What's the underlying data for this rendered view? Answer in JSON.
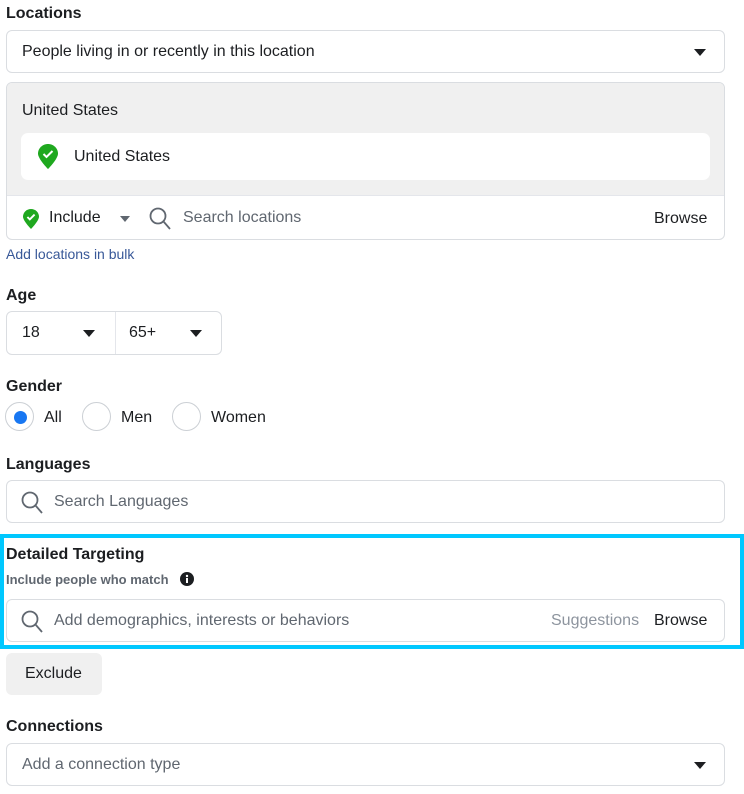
{
  "locations": {
    "label": "Locations",
    "type_select": "People living in or recently in this location",
    "group_title": "United States",
    "selected": [
      {
        "name": "United States",
        "icon": "location-pin-check-icon"
      }
    ],
    "include_label": "Include",
    "search_placeholder": "Search locations",
    "browse_label": "Browse",
    "bulk_link": "Add locations in bulk"
  },
  "age": {
    "label": "Age",
    "min": "18",
    "max": "65+"
  },
  "gender": {
    "label": "Gender",
    "options": [
      {
        "label": "All",
        "selected": true
      },
      {
        "label": "Men",
        "selected": false
      },
      {
        "label": "Women",
        "selected": false
      }
    ]
  },
  "languages": {
    "label": "Languages",
    "search_placeholder": "Search Languages"
  },
  "detailed_targeting": {
    "label": "Detailed Targeting",
    "sublabel": "Include people who match",
    "search_placeholder": "Add demographics, interests or behaviors",
    "suggestions_label": "Suggestions",
    "browse_label": "Browse",
    "highlight_color": "#00c8ff"
  },
  "exclude_button": "Exclude",
  "connections": {
    "label": "Connections",
    "placeholder": "Add a connection type"
  },
  "colors": {
    "accent": "#1877f2",
    "pin_green": "#1fa81f",
    "link": "#385898"
  }
}
